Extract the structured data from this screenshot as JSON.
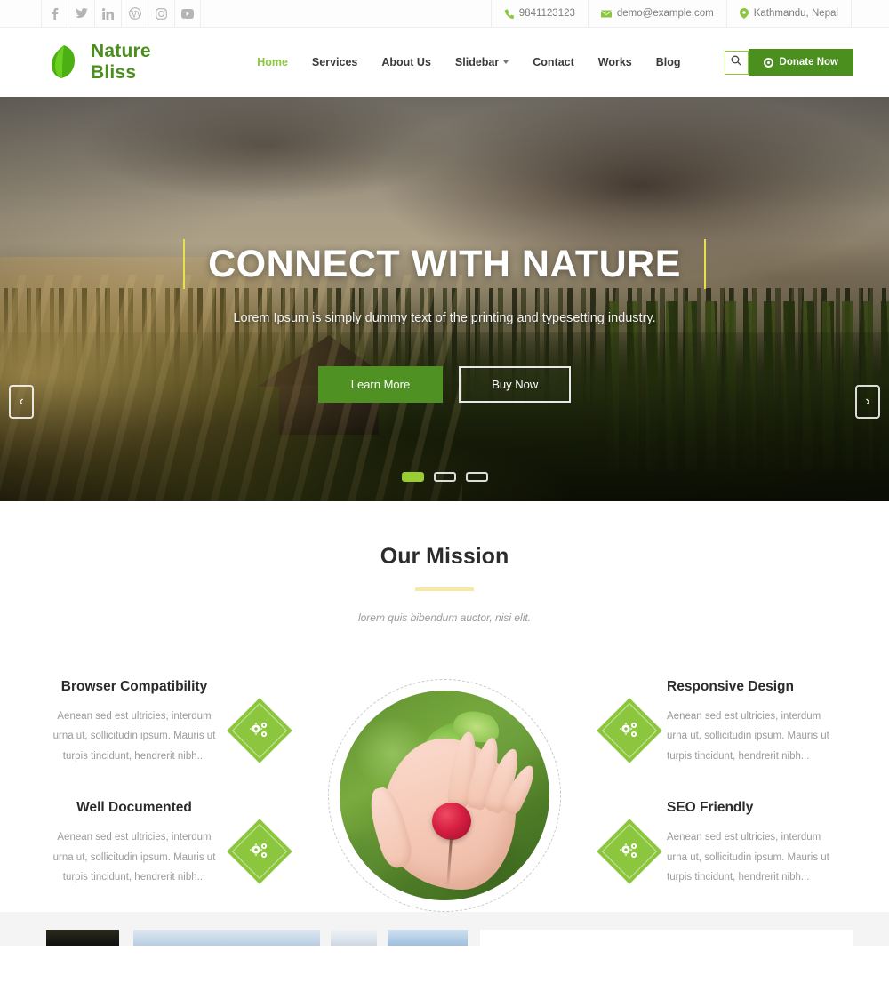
{
  "topbar": {
    "social": [
      {
        "name": "facebook-icon",
        "label": "f"
      },
      {
        "name": "twitter-icon",
        "label": "t"
      },
      {
        "name": "linkedin-icon",
        "label": "in"
      },
      {
        "name": "wordpress-icon",
        "label": "w"
      },
      {
        "name": "instagram-icon",
        "label": "ig"
      },
      {
        "name": "youtube-icon",
        "label": "yt"
      }
    ],
    "phone": "9841123123",
    "email": "demo@example.com",
    "location": "Kathmandu, Nepal"
  },
  "header": {
    "brand": "Nature Bliss",
    "nav": [
      {
        "label": "Home",
        "active": true
      },
      {
        "label": "Services",
        "active": false
      },
      {
        "label": "About Us",
        "active": false
      },
      {
        "label": "Slidebar",
        "active": false,
        "dropdown": true
      },
      {
        "label": "Contact",
        "active": false
      },
      {
        "label": "Works",
        "active": false
      },
      {
        "label": "Blog",
        "active": false
      }
    ],
    "search_icon": "search-icon",
    "donate_label": "Donate Now"
  },
  "hero": {
    "title": "CONNECT WITH NATURE",
    "subtitle": "Lorem Ipsum is simply dummy text of the printing and typesetting industry.",
    "primary_button": "Learn More",
    "secondary_button": "Buy Now",
    "prev_arrow": "‹",
    "next_arrow": "›",
    "slides_total": 3,
    "active_slide": 1
  },
  "mission": {
    "title": "Our Mission",
    "subtitle": "lorem quis bibendum auctor, nisi elit."
  },
  "features": {
    "body_text": "Aenean sed est ultricies, interdum urna ut, sollicitudin ipsum. Mauris ut turpis tincidunt, hendrerit nibh...",
    "left": [
      {
        "title": "Browser Compatibility",
        "desc": "Aenean sed est ultricies, interdum urna ut, sollicitudin ipsum. Mauris ut turpis tincidunt, hendrerit nibh..."
      },
      {
        "title": "Well Documented",
        "desc": "Aenean sed est ultricies, interdum urna ut, sollicitudin ipsum. Mauris ut turpis tincidunt, hendrerit nibh..."
      }
    ],
    "right": [
      {
        "title": "Responsive Design",
        "desc": "Aenean sed est ultricies, interdum urna ut, sollicitudin ipsum. Mauris ut turpis tincidunt, hendrerit nibh..."
      },
      {
        "title": "SEO Friendly",
        "desc": "Aenean sed est ultricies, interdum urna ut, sollicitudin ipsum. Mauris ut turpis tincidunt, hendrerit nibh..."
      }
    ],
    "icon_name": "gears-icon",
    "center_image_name": "hand-holding-radish-image"
  },
  "colors": {
    "accent_green": "#8cc63e",
    "dark_green": "#4b8f1f",
    "brand_green": "#4a8f1e",
    "yellow_rule": "#f7e9a0",
    "title_bar_yellow": "#e7e24a"
  }
}
